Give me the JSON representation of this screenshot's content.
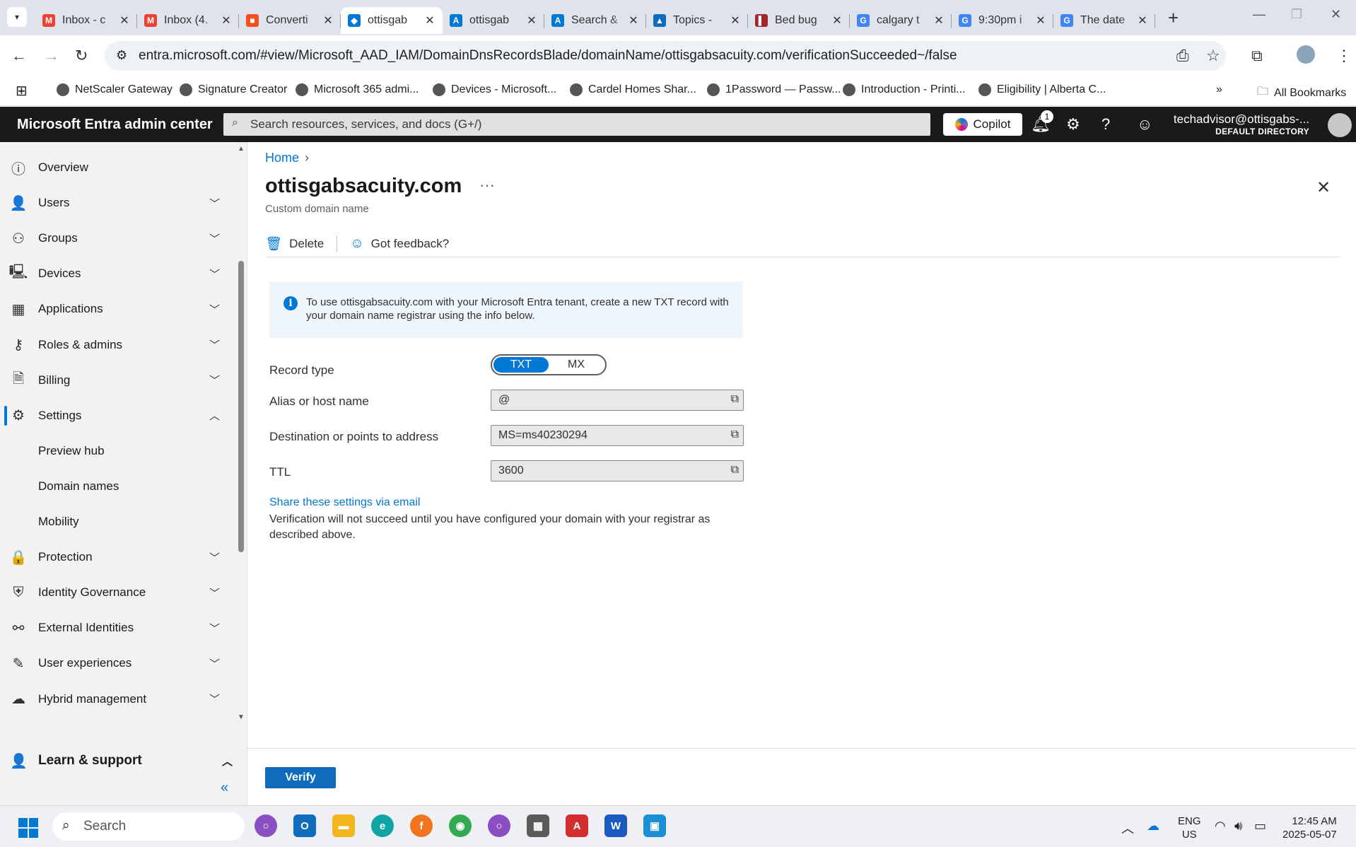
{
  "browser": {
    "tabs": [
      {
        "title": "Inbox - c",
        "icon": "gmail-icon",
        "color": "#ea4335",
        "glyph": "M"
      },
      {
        "title": "Inbox (4.",
        "icon": "gmail-icon",
        "color": "#ea4335",
        "glyph": "M"
      },
      {
        "title": "Converti",
        "icon": "microsoft-icon",
        "color": "#f25022",
        "glyph": "■"
      },
      {
        "title": "ottisgab",
        "icon": "entra-icon",
        "color": "#0078d4",
        "glyph": "◆",
        "active": true
      },
      {
        "title": "ottisgab",
        "icon": "azure-icon",
        "color": "#0078d4",
        "glyph": "A"
      },
      {
        "title": "Search &",
        "icon": "admin-icon",
        "color": "#0078d4",
        "glyph": "A"
      },
      {
        "title": "Topics -",
        "icon": "teams-icon",
        "color": "#0f6cbd",
        "glyph": "▲"
      },
      {
        "title": "Bed bug",
        "icon": "book-icon",
        "color": "#a4262c",
        "glyph": "▌"
      },
      {
        "title": "calgary t",
        "icon": "google-icon",
        "color": "#4285f4",
        "glyph": "G"
      },
      {
        "title": "9:30pm i",
        "icon": "google-icon",
        "color": "#4285f4",
        "glyph": "G"
      },
      {
        "title": "The date",
        "icon": "google-icon",
        "color": "#4285f4",
        "glyph": "G"
      }
    ],
    "url": "entra.microsoft.com/#view/Microsoft_AAD_IAM/DomainDnsRecordsBlade/domainName/ottisgabsacuity.com/verificationSucceeded~/false",
    "bookmarks": [
      "NetScaler Gateway",
      "Signature Creator",
      "Microsoft 365 admi...",
      "Devices - Microsoft...",
      "Cardel Homes Shar...",
      "1Password — Passw...",
      "Introduction - Printi...",
      "Eligibility | Alberta C..."
    ],
    "all_bookmarks": "All Bookmarks"
  },
  "header": {
    "brand": "Microsoft Entra admin center",
    "search_placeholder": "Search resources, services, and docs (G+/)",
    "copilot": "Copilot",
    "notification_count": "1",
    "user_email": "techadvisor@ottisgabs-...",
    "user_directory": "DEFAULT DIRECTORY"
  },
  "sidebar": {
    "items": [
      {
        "label": "Overview",
        "icon": "info-icon",
        "glyph": "ⓘ",
        "chevron": ""
      },
      {
        "label": "Users",
        "icon": "user-icon",
        "glyph": "👤",
        "chevron": "﹀"
      },
      {
        "label": "Groups",
        "icon": "groups-icon",
        "glyph": "⚇",
        "chevron": "﹀"
      },
      {
        "label": "Devices",
        "icon": "devices-icon",
        "glyph": "🖳",
        "chevron": "﹀"
      },
      {
        "label": "Applications",
        "icon": "applications-icon",
        "glyph": "▦",
        "chevron": "﹀"
      },
      {
        "label": "Roles & admins",
        "icon": "roles-icon",
        "glyph": "⚷",
        "chevron": "﹀"
      },
      {
        "label": "Billing",
        "icon": "billing-icon",
        "glyph": "🗎",
        "chevron": "﹀"
      },
      {
        "label": "Settings",
        "icon": "gear-icon",
        "glyph": "⚙",
        "chevron": "︿",
        "selected": true
      },
      {
        "label": "Preview hub",
        "sub": true
      },
      {
        "label": "Domain names",
        "sub": true
      },
      {
        "label": "Mobility",
        "sub": true
      },
      {
        "label": "Protection",
        "icon": "lock-icon",
        "glyph": "🔒",
        "chevron": "﹀"
      },
      {
        "label": "Identity Governance",
        "icon": "governance-icon",
        "glyph": "⛨",
        "chevron": "﹀"
      },
      {
        "label": "External Identities",
        "icon": "external-icon",
        "glyph": "⚯",
        "chevron": "﹀"
      },
      {
        "label": "User experiences",
        "icon": "user-experience-icon",
        "glyph": "✎",
        "chevron": "﹀"
      },
      {
        "label": "Hybrid management",
        "icon": "cloud-icon",
        "glyph": "☁",
        "chevron": "﹀"
      }
    ],
    "learn_support": "Learn & support"
  },
  "page": {
    "breadcrumb_home": "Home",
    "title": "ottisgabsacuity.com",
    "subtitle": "Custom domain name",
    "commands": {
      "delete": "Delete",
      "feedback": "Got feedback?"
    },
    "info_text": "To use ottisgabsacuity.com with your Microsoft Entra tenant, create a new TXT record with your domain name registrar using the info below.",
    "record_type_label": "Record type",
    "record_type_options": [
      "TXT",
      "MX"
    ],
    "alias_label": "Alias or host name",
    "alias_value": "@",
    "destination_label": "Destination or points to address",
    "destination_value": "MS=ms40230294",
    "ttl_label": "TTL",
    "ttl_value": "3600",
    "share_link": "Share these settings via email",
    "note": "Verification will not succeed until you have configured your domain with your registrar as described above.",
    "verify_button": "Verify"
  },
  "taskbar": {
    "search": "Search",
    "lang1": "ENG",
    "lang2": "US",
    "time": "12:45 AM",
    "date": "2025-05-07"
  }
}
